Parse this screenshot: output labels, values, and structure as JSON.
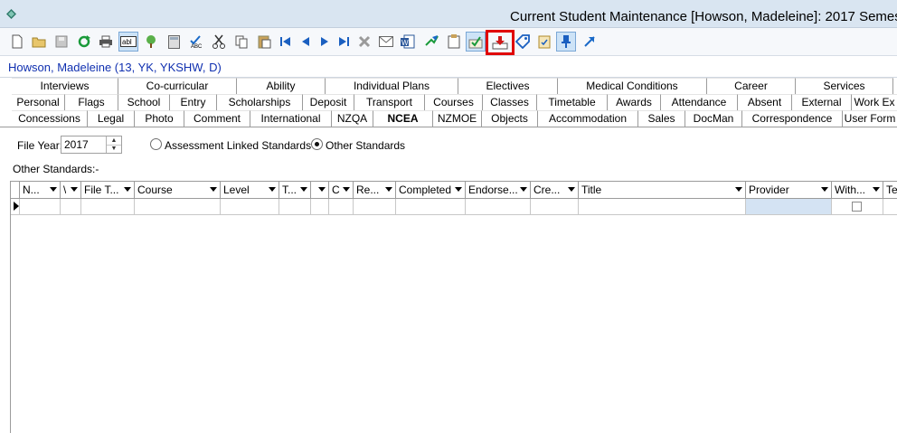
{
  "window": {
    "title": "Current Student Maintenance  [Howson, Madeleine]:  2017 Semes"
  },
  "toolbar": {
    "icons": [
      "new-icon",
      "open-icon",
      "save-icon",
      "refresh-icon",
      "print-icon",
      "textbox-icon",
      "tree-icon",
      "calculator-icon",
      "spellcheck-icon",
      "cut-icon",
      "copy-icon",
      "paste-icon",
      "first-record-icon",
      "previous-record-icon",
      "next-record-icon",
      "last-record-icon",
      "delete-icon",
      "email-icon",
      "word-icon",
      "export-icon",
      "clipboard-icon",
      "checklist-icon",
      "download-tray-icon",
      "tag-icon",
      "task-icon",
      "pin-icon",
      "open-link-icon"
    ]
  },
  "student": {
    "name": "Howson, Madeleine (13, YK, YKSHW, D)"
  },
  "tabs": {
    "row1": [
      "Interviews",
      "Co-curricular",
      "Ability",
      "Individual Plans",
      "Electives",
      "Medical Conditions",
      "Career",
      "Services"
    ],
    "row2": [
      "Personal",
      "Flags",
      "School",
      "Entry",
      "Scholarships",
      "Deposit",
      "Transport",
      "Courses",
      "Classes",
      "Timetable",
      "Awards",
      "Attendance",
      "Absent",
      "External",
      "Work Ex"
    ],
    "row3": [
      "Concessions",
      "Legal",
      "Photo",
      "Comment",
      "International",
      "NZQA",
      "NCEA",
      "NZMOE",
      "Objects",
      "Accommodation",
      "Sales",
      "DocMan",
      "Correspondence",
      "User Form"
    ],
    "active": "NCEA"
  },
  "form": {
    "file_year_label": "File Year:",
    "file_year_value": "2017",
    "radio_assessment": "Assessment Linked Standards",
    "radio_other": "Other Standards",
    "selected_option": "Other Standards"
  },
  "grid": {
    "section_label": "Other Standards:-",
    "columns": [
      "N...",
      "\\",
      "File T...",
      "Course",
      "Level",
      "T...",
      "",
      "C",
      "Re...",
      "Completed",
      "Endorse...",
      "Cre...",
      "Title",
      "Provider",
      "With...",
      "Te"
    ]
  },
  "colors": {
    "accent": "#1030b0",
    "highlight": "#e00000",
    "selected_cell": "#d4e3f3",
    "titlebar": "#d9e5f1"
  }
}
